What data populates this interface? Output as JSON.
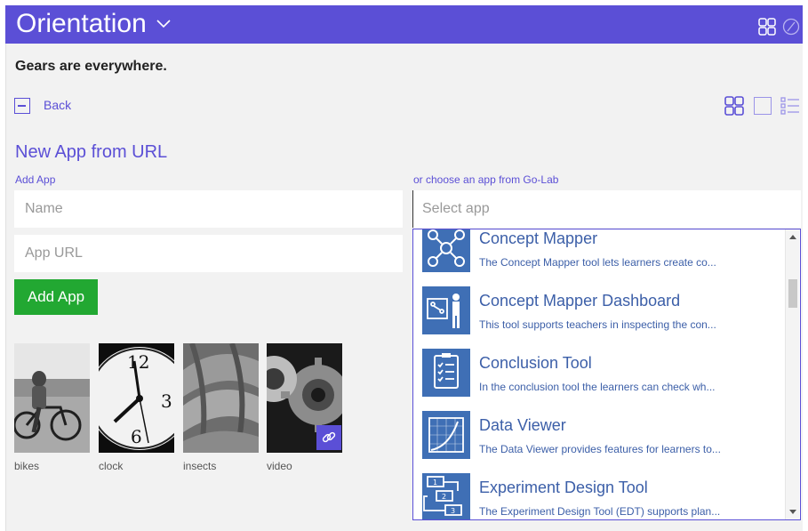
{
  "header": {
    "title": "Orientation",
    "accent": "#5b4fd6",
    "icons": [
      "chevron-down-icon",
      "grid-view-icon",
      "clock-icon"
    ]
  },
  "page": {
    "heading": "Gears are everywhere.",
    "back_label": "Back"
  },
  "new_app": {
    "section_title": "New App from URL",
    "add_label": "Add App",
    "name_placeholder": "Name",
    "url_placeholder": "App URL",
    "add_button": "Add App",
    "button_color": "#22a832"
  },
  "go_lab": {
    "choose_label": "or choose an app from Go-Lab",
    "select_placeholder": "Select app",
    "apps": [
      {
        "name": "Concept Mapper",
        "description": "The Concept Mapper tool lets learners create co..."
      },
      {
        "name": "Concept Mapper Dashboard",
        "description": "This tool supports teachers in inspecting the con..."
      },
      {
        "name": "Conclusion Tool",
        "description": "In the conclusion tool the learners can check wh..."
      },
      {
        "name": "Data Viewer",
        "description": "The Data Viewer provides features for learners to..."
      },
      {
        "name": "Experiment Design Tool",
        "description": "The Experiment Design Tool (EDT) supports plan..."
      }
    ]
  },
  "thumbnails": [
    {
      "label": "bikes"
    },
    {
      "label": "clock"
    },
    {
      "label": "insects"
    },
    {
      "label": "video"
    }
  ]
}
